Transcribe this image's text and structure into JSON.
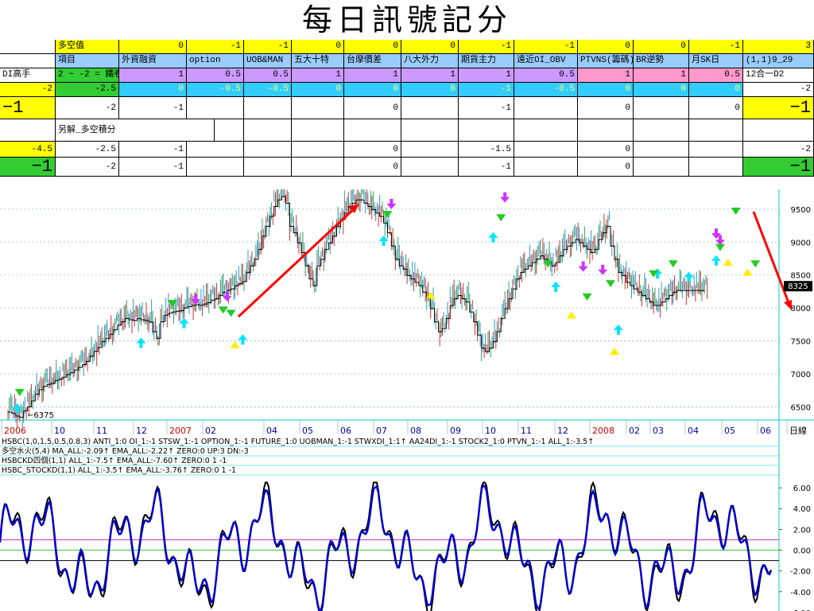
{
  "title": "每日訊號記分",
  "table": {
    "rows": [
      [
        "",
        "多空值",
        "0",
        "-1",
        "-1",
        "0",
        "0",
        "0",
        "-1",
        "-1",
        "0",
        "0",
        "-1",
        "3"
      ],
      [
        "",
        "項目",
        "外資融資",
        "option",
        "UOB&MAN",
        "五大十特",
        "台摩價差",
        "八大外力",
        "期貨主力",
        "遠近OI_OBV",
        "PTVNS(籌碼)",
        "BR逆勢",
        "月SK日",
        "(1,1)9_29"
      ],
      [
        "DI高手",
        "2 ~ -2 = 鐵卷",
        "1",
        "0.5",
        "0.5",
        "1",
        "1",
        "1",
        "1",
        "0.5",
        "1",
        "1",
        "0.5",
        "12合一D2"
      ],
      [
        "-2",
        "-2.5",
        "0",
        "-0.5",
        "-0.5",
        "0",
        "0",
        "0",
        "-1",
        "-0.5",
        "0",
        "0",
        "0",
        "-2"
      ],
      [
        "−1",
        "-2",
        "-1",
        "",
        "",
        "",
        "0",
        "",
        "-1",
        "",
        "0",
        "",
        "0",
        "−1"
      ],
      [
        "",
        "另解_多空積分",
        "",
        "",
        "",
        "",
        "",
        "",
        "",
        "",
        "",
        "",
        "",
        ""
      ],
      [
        "-4.5",
        "-2.5",
        "-1",
        "",
        "",
        "",
        "0",
        "",
        "-1.5",
        "",
        "0",
        "",
        "",
        "-2"
      ],
      [
        "−1",
        "-2",
        "-1",
        "",
        "",
        "",
        "0",
        "",
        "-1",
        "",
        "0",
        "",
        "",
        "−1"
      ]
    ]
  },
  "indicator_lines": [
    "HSBC(1,0,1.5,0.5,0.8,3) ANTI_1:0 OI_1:-1 STSW_1:-1 OPTION_1:-1 FUTURE_1:0 UOBMAN_1:-1 STWXDI_1:1↑ AA24DI_1:-1 STOCK2_1:0 PTVN_1:-1 ALL_1:-3.5↑",
    "多空水火(5,4) MA_ALL:-2.09↑ EMA_ALL:-2.22↑ ZERO:0 UP:3 DN:-3",
    "HSBCKD四個(1,1) ALL_1:-7.5↑ EMA_ALL:-7.60↑ ZERO:0 1 -1",
    "HSBC_STOCKD(1,1) ALL_1:-3.5↑ EMA_ALL:-3.76↑ ZERO:0 1 -1"
  ],
  "chart_data": [
    {
      "type": "line",
      "title": "",
      "x_tick_labels": [
        "2006",
        "10",
        "11",
        "12",
        "2007",
        "02",
        "04",
        "05",
        "06",
        "07",
        "08",
        "09",
        "10",
        "11",
        "12",
        "2008",
        "02",
        "03",
        "04",
        "05",
        "06",
        "日線"
      ],
      "y_tick_labels": [
        "9500",
        "9000",
        "8500",
        "8000",
        "7500",
        "7000",
        "6500"
      ],
      "ylim": [
        6300,
        9800
      ],
      "last_price_label": "8325",
      "low_label": "6375",
      "x": [
        0,
        5,
        10,
        15,
        20,
        25,
        30,
        35,
        40,
        45,
        50,
        55,
        60,
        65,
        70,
        75,
        80,
        85,
        90,
        95,
        100,
        105,
        110,
        115,
        120,
        125,
        130,
        135,
        140,
        145,
        150,
        155,
        160,
        165,
        170,
        175,
        180,
        185,
        190,
        195,
        200,
        205,
        210,
        215,
        220,
        225,
        230,
        235,
        240,
        245,
        250,
        255,
        260,
        265,
        270,
        275,
        280,
        285,
        290,
        295,
        300,
        305,
        310,
        315,
        320,
        325,
        330,
        335,
        340,
        345,
        350,
        355,
        360,
        365,
        370,
        375,
        380,
        385,
        390,
        395,
        400,
        405,
        410,
        415,
        420,
        425,
        430,
        435,
        440,
        445,
        450,
        455,
        460,
        465,
        470,
        475,
        480,
        485,
        490,
        495,
        500,
        505,
        510,
        515,
        520,
        525,
        530,
        535,
        540,
        545,
        550,
        555,
        560,
        565,
        570,
        575,
        580,
        585,
        590,
        595,
        600,
        605,
        610,
        615,
        620,
        625,
        630,
        635,
        640,
        645,
        650,
        655,
        660,
        665,
        670,
        675,
        680,
        685,
        690,
        695,
        700,
        705,
        710,
        715,
        720,
        725,
        730,
        735,
        740,
        745,
        750,
        755,
        760,
        765,
        770,
        775,
        780,
        785,
        790,
        795,
        800,
        805,
        810,
        815,
        820,
        825,
        830,
        835,
        840,
        845,
        850,
        855,
        860,
        865,
        870,
        875,
        880,
        885,
        890,
        895,
        900,
        905,
        910,
        915,
        920,
        925,
        930,
        935,
        940,
        945,
        950,
        955,
        960,
        965,
        970
      ],
      "price": [
        6480,
        6460,
        6420,
        6400,
        6500,
        6560,
        6650,
        6750,
        6820,
        6870,
        6900,
        6920,
        6960,
        6980,
        7010,
        7050,
        7080,
        7120,
        7160,
        7200,
        7250,
        7330,
        7400,
        7460,
        7550,
        7600,
        7660,
        7730,
        7800,
        7850,
        7900,
        7880,
        7870,
        7900,
        7880,
        7870,
        7850,
        7700,
        7600,
        7850,
        7950,
        7980,
        8000,
        8010,
        8020,
        8060,
        8080,
        8100,
        8110,
        8100,
        8120,
        8140,
        8180,
        8200,
        8250,
        8300,
        8330,
        8350,
        8400,
        8430,
        8460,
        8600,
        8700,
        8800,
        8950,
        9150,
        9300,
        9450,
        9600,
        9700,
        9750,
        9650,
        9300,
        9200,
        9050,
        8900,
        8700,
        8500,
        8400,
        8700,
        8800,
        8950,
        9050,
        9150,
        9300,
        9400,
        9500,
        9600,
        9650,
        9700,
        9700,
        9650,
        9600,
        9550,
        9500,
        9450,
        9350,
        9200,
        9000,
        8800,
        8700,
        8650,
        8550,
        8500,
        8450,
        8400,
        8300,
        8200,
        8050,
        7850,
        7700,
        7750,
        7900,
        8100,
        8200,
        8250,
        8200,
        8150,
        8000,
        7850,
        7650,
        7450,
        7400,
        7450,
        7550,
        7700,
        7900,
        8050,
        8200,
        8350,
        8500,
        8600,
        8650,
        8700,
        8750,
        8800,
        8850,
        8800,
        8750,
        8700,
        8750,
        8850,
        8950,
        9000,
        9050,
        9100,
        9050,
        9000,
        8950,
        8900,
        8950,
        9100,
        9200,
        9300,
        9000,
        8800,
        8600,
        8550,
        8450,
        8400,
        8350,
        8300,
        8250,
        8200,
        8150,
        8100,
        8100,
        8150,
        8200,
        8250,
        8300,
        8325,
        8325,
        8325,
        8325,
        8325,
        8325,
        8325,
        8325
      ]
    },
    {
      "type": "line",
      "title": "",
      "y_tick_labels": [
        "6.00",
        "4.00",
        "2.00",
        "0.00",
        "-2.00",
        "-4.00",
        "-6.00"
      ],
      "ylim": [
        -6,
        7
      ],
      "reference_lines": [
        1,
        0,
        -1
      ],
      "series": [
        {
          "name": "ALL_1",
          "color": "#000000"
        },
        {
          "name": "EMA_ALL",
          "color": "#0000cc"
        }
      ]
    }
  ],
  "colors": {
    "up_arrow": "#00e5ff",
    "down_arrow": "#cc33ff",
    "green_marker": "#22cc22",
    "yellow_marker": "#ffee00",
    "trend_arrow": "#ff0000"
  }
}
